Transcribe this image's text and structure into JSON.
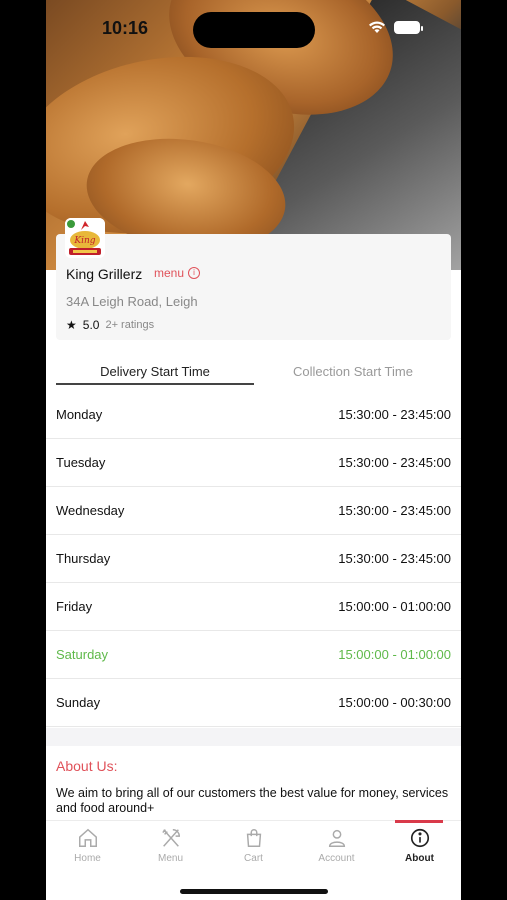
{
  "status_bar": {
    "time": "10:16"
  },
  "restaurant": {
    "name": "King Grillerz",
    "menu_link": "menu",
    "address": "34A Leigh Road, Leigh",
    "rating": "5.0",
    "rating_count": "2+ ratings"
  },
  "tabs": {
    "delivery": "Delivery Start Time",
    "collection": "Collection Start Time"
  },
  "schedule": [
    {
      "day": "Monday",
      "hours": "15:30:00 - 23:45:00"
    },
    {
      "day": "Tuesday",
      "hours": "15:30:00 - 23:45:00"
    },
    {
      "day": "Wednesday",
      "hours": "15:30:00 - 23:45:00"
    },
    {
      "day": "Thursday",
      "hours": "15:30:00 - 23:45:00"
    },
    {
      "day": "Friday",
      "hours": "15:00:00 - 01:00:00"
    },
    {
      "day": "Saturday",
      "hours": "15:00:00 - 01:00:00"
    },
    {
      "day": "Sunday",
      "hours": "15:00:00 - 00:30:00"
    }
  ],
  "about": {
    "title": "About Us:",
    "text": "We aim to bring all of our customers the best value for money, services and food around+"
  },
  "nav": {
    "home": "Home",
    "menu": "Menu",
    "cart": "Cart",
    "account": "Account",
    "about": "About"
  },
  "colors": {
    "accent": "#e0525a",
    "today": "#5fb94a",
    "active_bar": "#d93a4a"
  }
}
